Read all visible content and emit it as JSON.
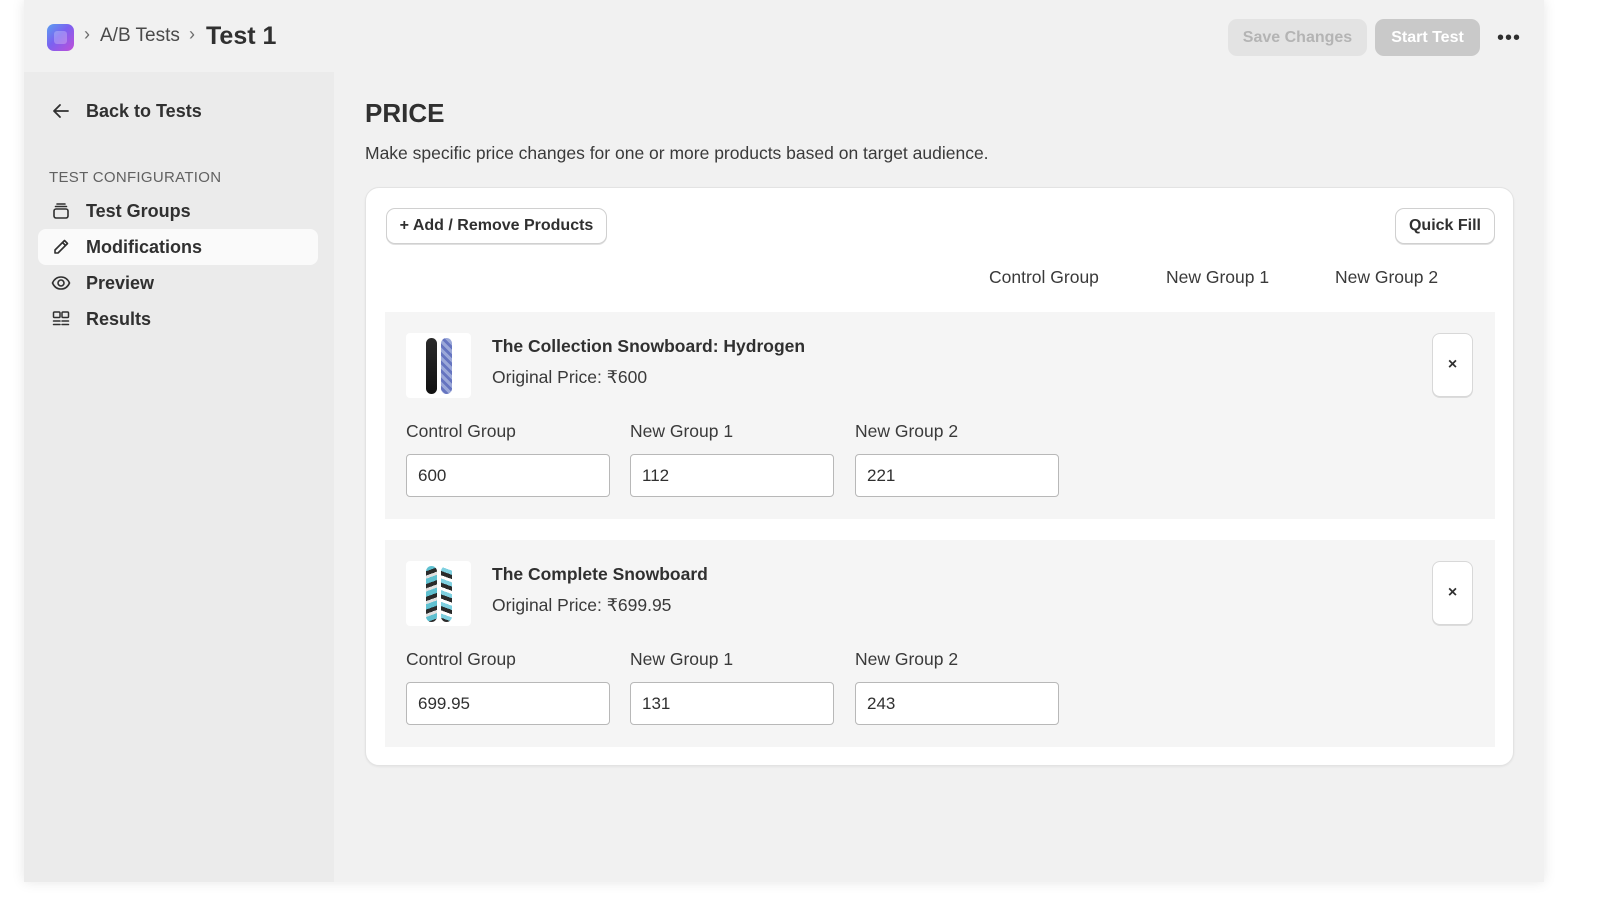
{
  "header": {
    "breadcrumb_parent": "A/B Tests",
    "breadcrumb_current": "Test 1",
    "save_label": "Save Changes",
    "start_label": "Start Test",
    "more_label": "•••"
  },
  "sidebar": {
    "back_label": "Back to Tests",
    "section_label": "TEST CONFIGURATION",
    "items": [
      {
        "label": "Test Groups",
        "icon": "stack-icon",
        "active": false
      },
      {
        "label": "Modifications",
        "icon": "pencil-icon",
        "active": true
      },
      {
        "label": "Preview",
        "icon": "eye-icon",
        "active": false
      },
      {
        "label": "Results",
        "icon": "grid-icon",
        "active": false
      }
    ]
  },
  "main": {
    "title": "PRICE",
    "description": "Make specific price changes for one or more products based on target audience.",
    "add_remove_label": "+ Add / Remove Products",
    "quick_fill_label": "Quick Fill",
    "column_headers": [
      "Control Group",
      "New Group 1",
      "New Group 2"
    ],
    "products": [
      {
        "name": "The Collection Snowboard: Hydrogen",
        "original_price": "Original Price: ₹600",
        "remove_label": "×",
        "fields": [
          {
            "label": "Control Group",
            "value": "600"
          },
          {
            "label": "New Group 1",
            "value": "112"
          },
          {
            "label": "New Group 2",
            "value": "221"
          }
        ]
      },
      {
        "name": "The Complete Snowboard",
        "original_price": "Original Price: ₹699.95",
        "remove_label": "×",
        "fields": [
          {
            "label": "Control Group",
            "value": "699.95"
          },
          {
            "label": "New Group 1",
            "value": "131"
          },
          {
            "label": "New Group 2",
            "value": "243"
          }
        ]
      }
    ]
  },
  "colors": {
    "background": "#f1f1f1",
    "sidebar": "#ebebeb",
    "card": "#ffffff",
    "text": "#303030",
    "disabled_button": "#e3e3e3",
    "primary_disabled": "#c9c9c9"
  }
}
